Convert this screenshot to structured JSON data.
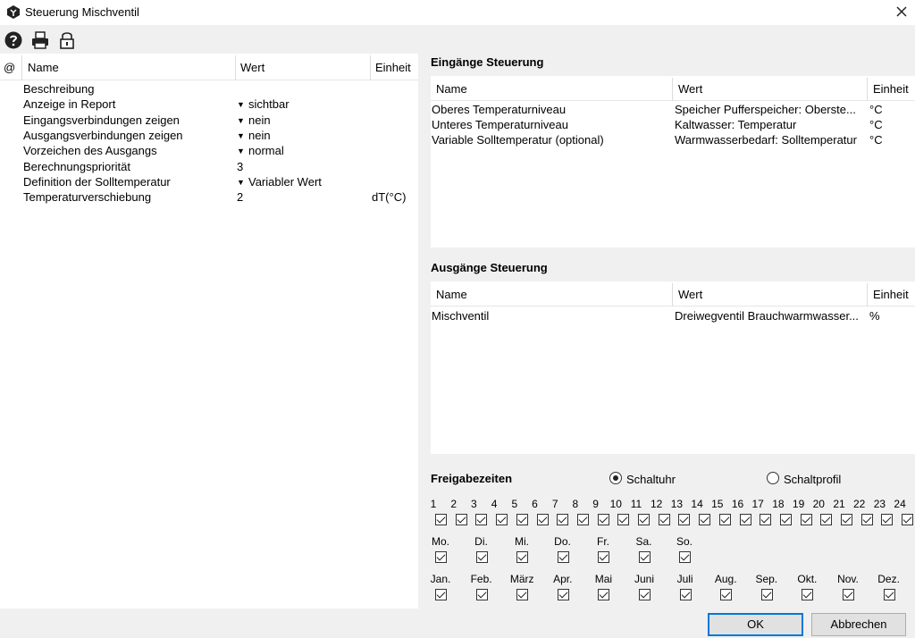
{
  "window": {
    "title": "Steuerung Mischventil",
    "close": "close"
  },
  "toolbar": {
    "icons": [
      "help-icon",
      "print-icon",
      "lock-icon"
    ]
  },
  "properties": {
    "columns": [
      "@",
      "Name",
      "Wert",
      "Einheit"
    ],
    "rows": [
      {
        "name": "Beschreibung",
        "value": "",
        "unit": "",
        "dropdown": false
      },
      {
        "name": "Anzeige in Report",
        "value": "sichtbar",
        "unit": "",
        "dropdown": true
      },
      {
        "name": "Eingangsverbindungen zeigen",
        "value": "nein",
        "unit": "",
        "dropdown": true
      },
      {
        "name": "Ausgangsverbindungen zeigen",
        "value": "nein",
        "unit": "",
        "dropdown": true
      },
      {
        "name": "Vorzeichen des Ausgangs",
        "value": "normal",
        "unit": "",
        "dropdown": true
      },
      {
        "name": "Berechnungspriorität",
        "value": "3",
        "unit": "",
        "dropdown": false
      },
      {
        "name": "Definition der Solltemperatur",
        "value": "Variabler Wert",
        "unit": "",
        "dropdown": true
      },
      {
        "name": "Temperaturverschiebung",
        "value": "2",
        "unit": "dT(°C)",
        "dropdown": false
      }
    ]
  },
  "inputs": {
    "title": "Eingänge Steuerung",
    "columns": [
      "Name",
      "Wert",
      "Einheit"
    ],
    "rows": [
      {
        "name": "Oberes Temperaturniveau",
        "value": "Speicher Pufferspeicher: Oberste...",
        "unit": "°C"
      },
      {
        "name": "Unteres Temperaturniveau",
        "value": "Kaltwasser: Temperatur",
        "unit": "°C"
      },
      {
        "name": "Variable Solltemperatur (optional)",
        "value": "Warmwasserbedarf: Solltemperatur",
        "unit": "°C"
      }
    ]
  },
  "outputs": {
    "title": "Ausgänge Steuerung",
    "columns": [
      "Name",
      "Wert",
      "Einheit"
    ],
    "rows": [
      {
        "name": "Mischventil",
        "value": "Dreiwegventil Brauchwarmwasser...",
        "unit": "%"
      }
    ]
  },
  "release": {
    "title": "Freigabezeiten",
    "mode_options": [
      {
        "label": "Schaltuhr",
        "selected": true
      },
      {
        "label": "Schaltprofil",
        "selected": false
      }
    ],
    "hours": [
      "1",
      "2",
      "3",
      "4",
      "5",
      "6",
      "7",
      "8",
      "9",
      "10",
      "11",
      "12",
      "13",
      "14",
      "15",
      "16",
      "17",
      "18",
      "19",
      "20",
      "21",
      "22",
      "23",
      "24"
    ],
    "hours_checked": [
      true,
      true,
      true,
      true,
      true,
      true,
      true,
      true,
      true,
      true,
      true,
      true,
      true,
      true,
      true,
      true,
      true,
      true,
      true,
      true,
      true,
      true,
      true,
      true
    ],
    "days": [
      "Mo.",
      "Di.",
      "Mi.",
      "Do.",
      "Fr.",
      "Sa.",
      "So."
    ],
    "days_checked": [
      true,
      true,
      true,
      true,
      true,
      true,
      true
    ],
    "months": [
      "Jan.",
      "Feb.",
      "März",
      "Apr.",
      "Mai",
      "Juni",
      "Juli",
      "Aug.",
      "Sep.",
      "Okt.",
      "Nov.",
      "Dez."
    ],
    "months_checked": [
      true,
      true,
      true,
      true,
      true,
      true,
      true,
      true,
      true,
      true,
      true,
      true
    ]
  },
  "buttons": {
    "ok": "OK",
    "cancel": "Abbrechen"
  }
}
